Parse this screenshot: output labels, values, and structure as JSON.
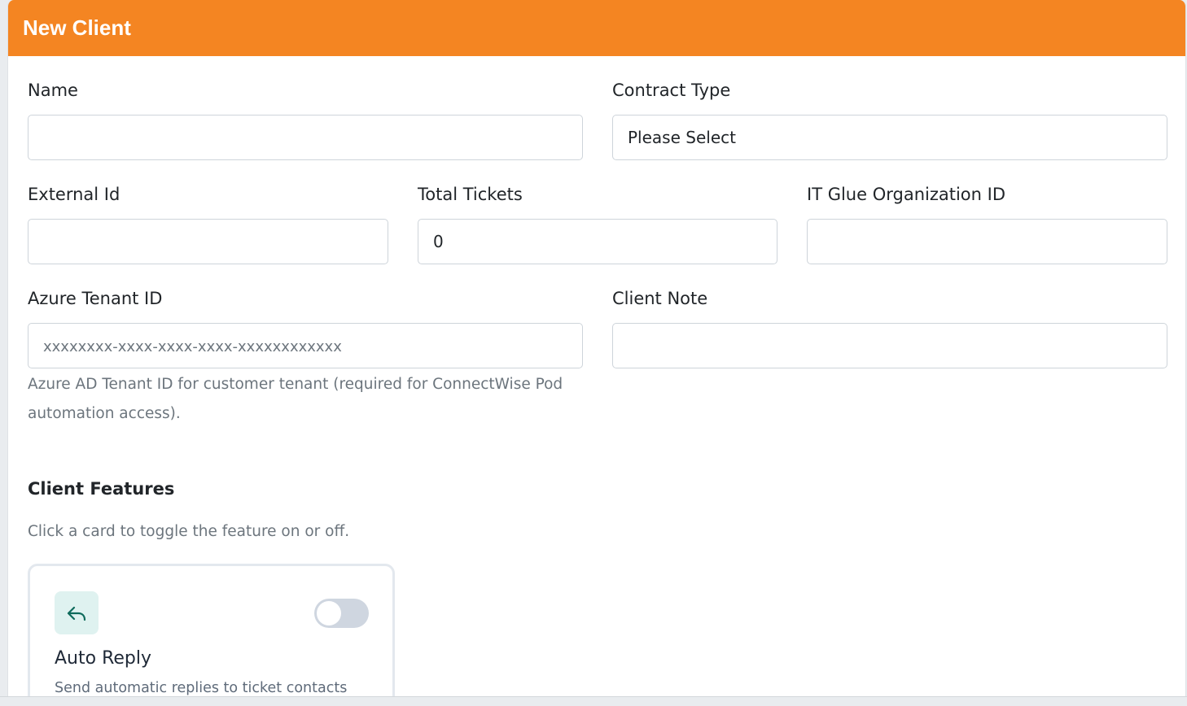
{
  "header": {
    "title": "New Client"
  },
  "form": {
    "name": {
      "label": "Name",
      "value": ""
    },
    "contract_type": {
      "label": "Contract Type",
      "selected": "Please Select"
    },
    "external_id": {
      "label": "External Id",
      "value": ""
    },
    "total_tickets": {
      "label": "Total Tickets",
      "value": "0"
    },
    "it_glue_org_id": {
      "label": "IT Glue Organization ID",
      "value": ""
    },
    "azure_tenant_id": {
      "label": "Azure Tenant ID",
      "placeholder": "xxxxxxxx-xxxx-xxxx-xxxx-xxxxxxxxxxxx",
      "help_line1": "Azure AD Tenant ID for customer tenant (required for ConnectWise Pod",
      "help_line2": "automation access)."
    },
    "client_note": {
      "label": "Client Note",
      "value": ""
    }
  },
  "features": {
    "title": "Client Features",
    "subtitle": "Click a card to toggle the feature on or off.",
    "items": [
      {
        "icon": "reply-icon",
        "title": "Auto Reply",
        "description": "Send automatic replies to ticket contacts",
        "enabled": false
      }
    ]
  },
  "colors": {
    "header_bg": "#f48522",
    "icon_bg": "#dff2f0",
    "icon_fg": "#0f6b5c",
    "toggle_off": "#cfd6e0"
  }
}
